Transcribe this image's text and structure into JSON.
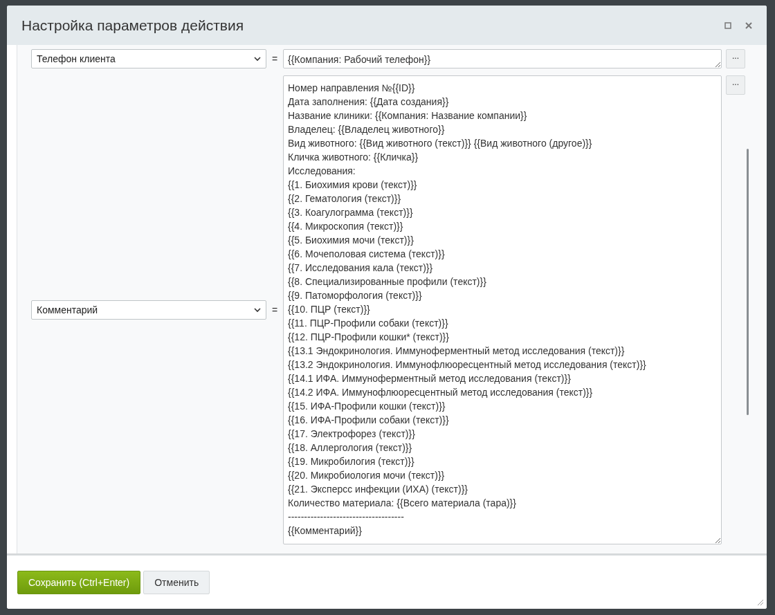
{
  "window": {
    "title": "Настройка параметров действия"
  },
  "rows": [
    {
      "field": "Телефон клиента",
      "operator": "=",
      "value": "{{Компания: Рабочий телефон}}",
      "more": "..."
    },
    {
      "field": "Комментарий",
      "operator": "=",
      "value": "Номер направления №{{ID}}\nДата заполнения: {{Дата создания}}\nНазвание клиники: {{Компания: Название компании}}\nВладелец: {{Владелец животного}}\nВид животного: {{Вид животного (текст)}} {{Вид животного (другое)}}\nКличка животного: {{Кличка}}\nИсследования:\n{{1. Биохимия крови (текст)}}\n{{2. Гематология (текст)}}\n{{3. Коагулограмма (текст)}}\n{{4. Микроскопия (текст)}}\n{{5. Биохимия мочи (текст)}}\n{{6. Мочеполовая система (текст)}}\n{{7. Исследования кала (текст)}}\n{{8. Специализированные профили (текст)}}\n{{9. Патоморфология (текст)}}\n{{10. ПЦР (текст)}}\n{{11. ПЦР-Профили собаки (текст)}}\n{{12. ПЦР-Профили кошки* (текст)}}\n{{13.1 Эндокринология. Иммуноферментный метод исследования (текст)}}\n{{13.2 Эндокринология. Иммунофлюоресцентный метод исследования (текст)}}\n{{14.1 ИФА. Иммуноферментный метод исследования (текст)}}\n{{14.2 ИФА. Иммунофлюоресцентный метод исследования (текст)}}\n{{15. ИФА-Профили кошки (текст)}}\n{{16. ИФА-Профили собаки (текст)}}\n{{17. Электрофорез (текст)}}\n{{18. Аллергология (текст)}}\n{{19. Микробилогия (текст)}}\n{{20. Микробиология мочи (текст)}}\n{{21. Эксперсс инфекции (ИХА) (текст)}}\nКоличество материала: {{Всего материала (тара)}}\n------------------------------------\n{{Комментарий}}",
      "more": "..."
    }
  ],
  "buttons": [
    {
      "label": "Сохранить (Ctrl+Enter)",
      "kind": "primary"
    },
    {
      "label": "Отменить",
      "kind": "secondary"
    }
  ]
}
